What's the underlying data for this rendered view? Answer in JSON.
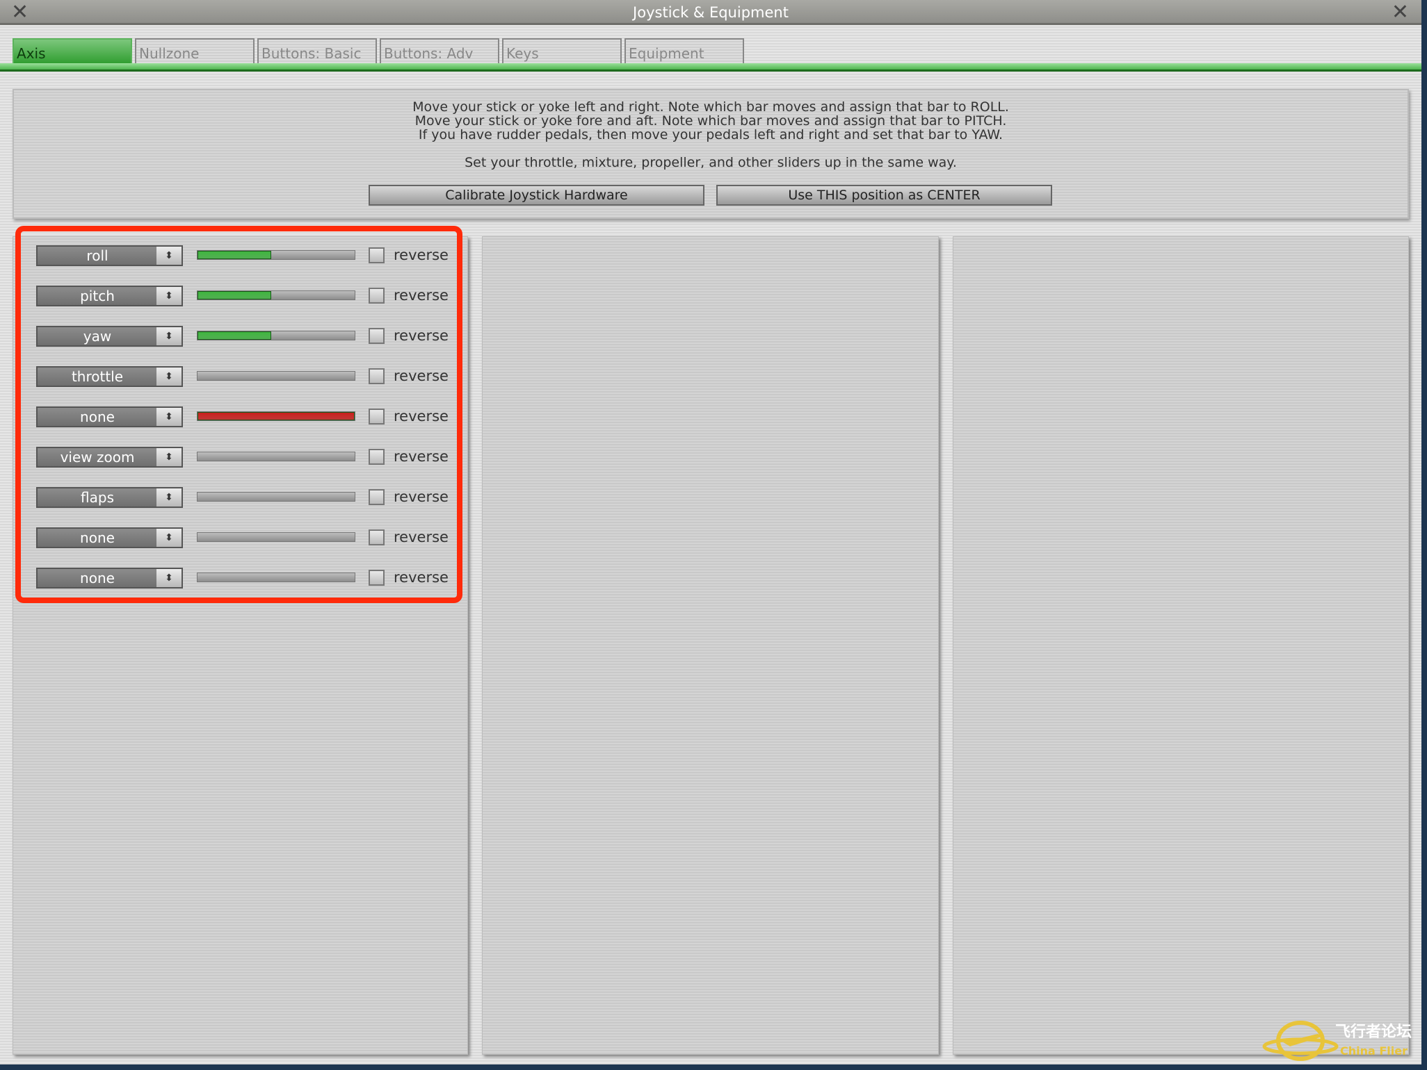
{
  "window": {
    "title": "Joystick & Equipment",
    "close_icon": "close-icon"
  },
  "tabs": [
    {
      "label": "Axis",
      "active": true
    },
    {
      "label": "Nullzone"
    },
    {
      "label": "Buttons: Basic"
    },
    {
      "label": "Buttons: Adv"
    },
    {
      "label": "Keys"
    },
    {
      "label": "Equipment"
    }
  ],
  "instructions": [
    "Move your stick or yoke left and right. Note which bar moves and assign that bar to ROLL.",
    "Move your stick or yoke fore and aft. Note which bar moves and assign that bar to PITCH.",
    "If you have rudder pedals, then move your pedals left and right and set that bar to YAW.",
    "Set your throttle, mixture, propeller, and other sliders up in the same way."
  ],
  "buttons": {
    "calibrate": "Calibrate Joystick Hardware",
    "center": "Use THIS position as CENTER"
  },
  "axes": [
    {
      "assignment": "roll",
      "fill": 0.47,
      "color": "#3fb43f",
      "reverse": false,
      "reverse_label": "reverse"
    },
    {
      "assignment": "pitch",
      "fill": 0.47,
      "color": "#3fb43f",
      "reverse": false,
      "reverse_label": "reverse"
    },
    {
      "assignment": "yaw",
      "fill": 0.47,
      "color": "#3fb43f",
      "reverse": false,
      "reverse_label": "reverse"
    },
    {
      "assignment": "throttle",
      "fill": 0,
      "color": "#3fb43f",
      "reverse": false,
      "reverse_label": "reverse"
    },
    {
      "assignment": "none",
      "fill": 1.0,
      "color": "#c8201c",
      "reverse": false,
      "reverse_label": "reverse"
    },
    {
      "assignment": "view zoom",
      "fill": 0,
      "color": "#3fb43f",
      "reverse": false,
      "reverse_label": "reverse"
    },
    {
      "assignment": "flaps",
      "fill": 0,
      "color": "#3fb43f",
      "reverse": false,
      "reverse_label": "reverse"
    },
    {
      "assignment": "none",
      "fill": 0,
      "color": "#3fb43f",
      "reverse": false,
      "reverse_label": "reverse"
    },
    {
      "assignment": "none",
      "fill": 0,
      "color": "#3fb43f",
      "reverse": false,
      "reverse_label": "reverse"
    }
  ],
  "watermark": {
    "text_cn": "飞行者论坛",
    "text_en": "China Flier"
  },
  "colors": {
    "highlight": "#ff2a0a",
    "tab_active": "#2f9d2f"
  }
}
